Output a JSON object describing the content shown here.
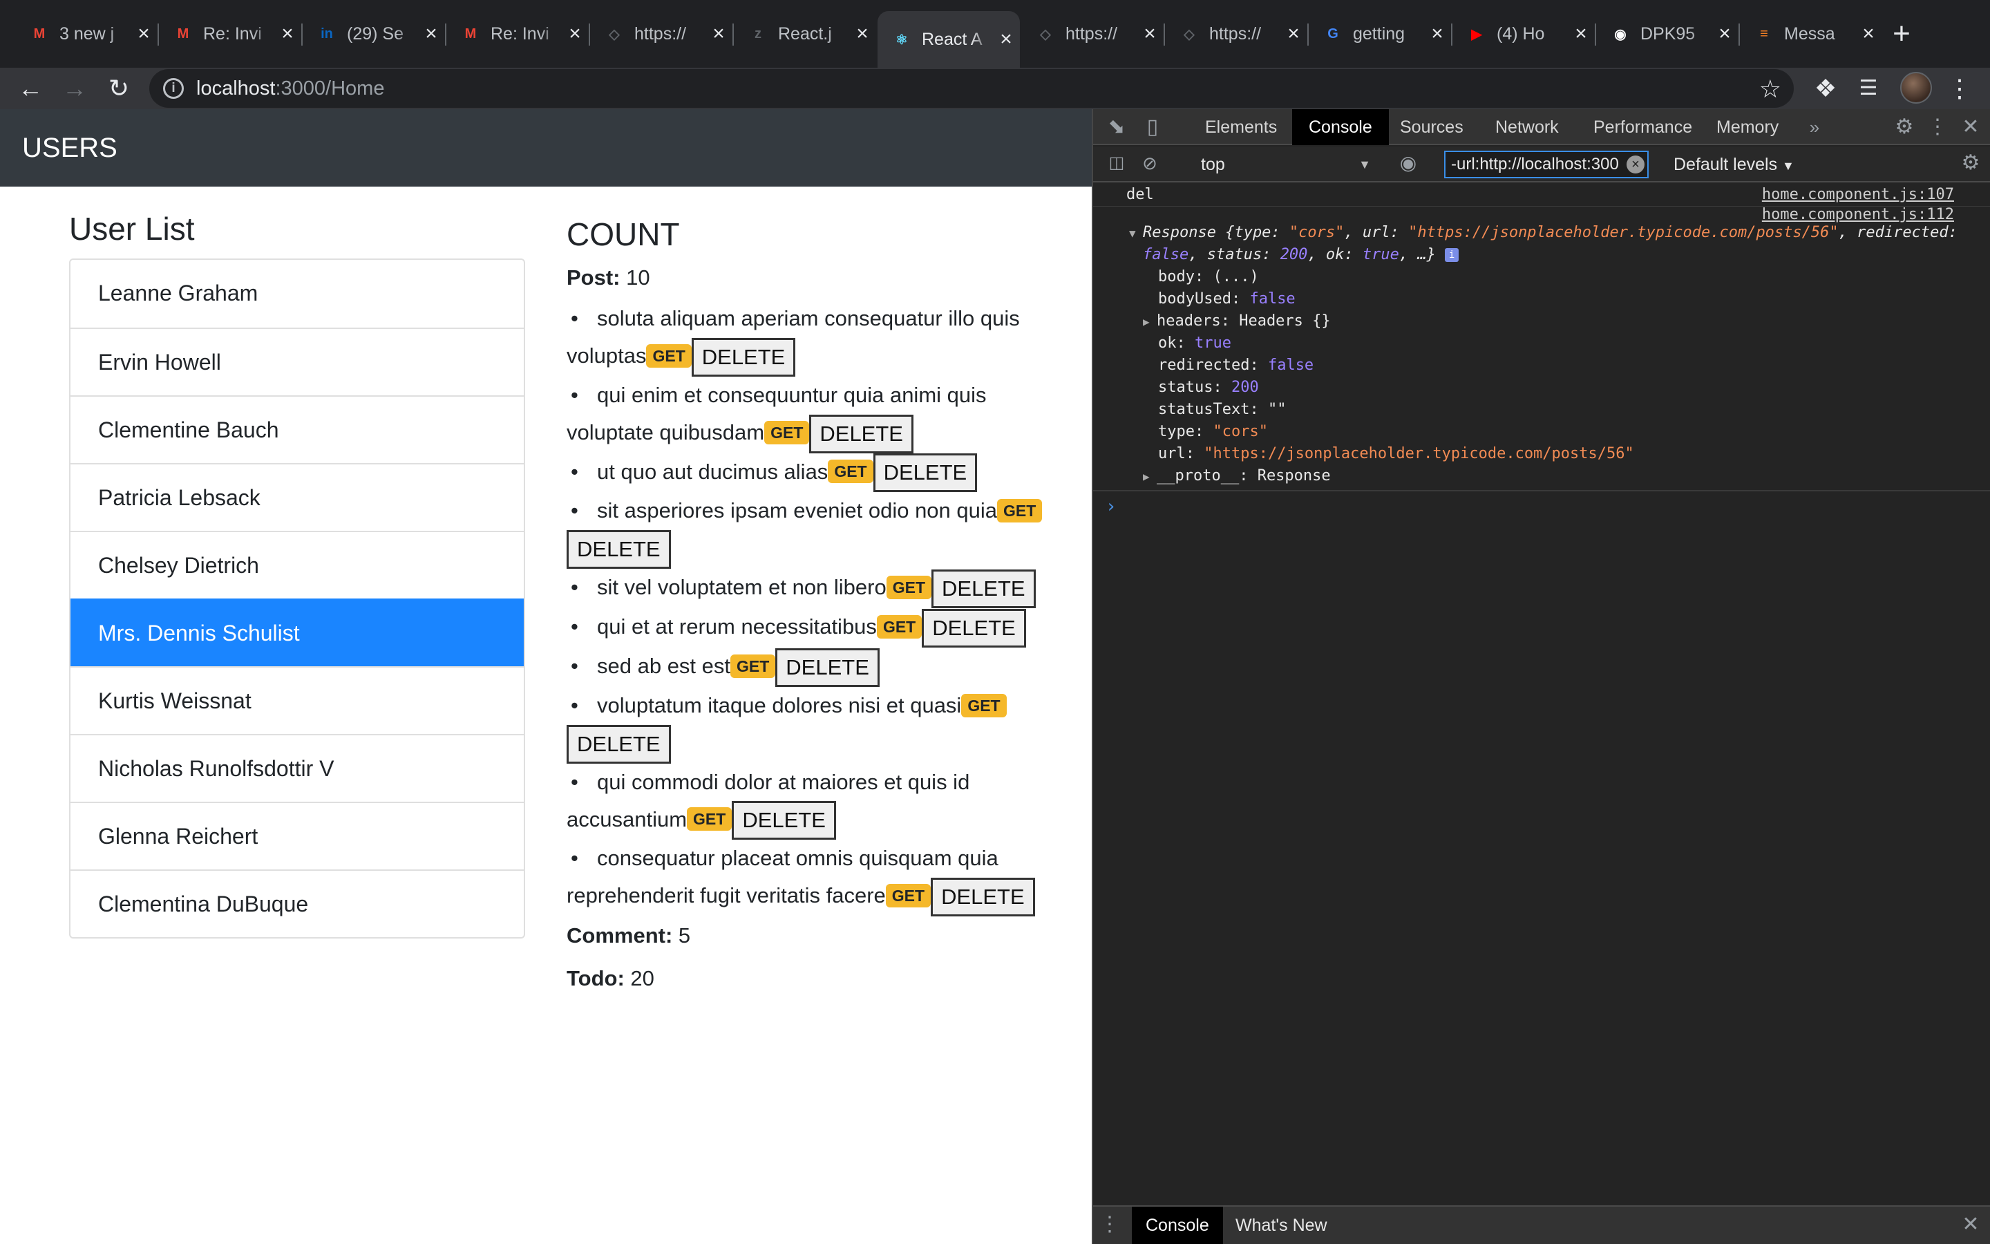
{
  "browser": {
    "tabs": [
      {
        "title": "3 new j",
        "icon": "gmail-icon",
        "color": "#ea4335"
      },
      {
        "title": "Re: Invi",
        "icon": "gmail-icon",
        "color": "#ea4335"
      },
      {
        "title": "(29) Se",
        "icon": "linkedin-icon",
        "color": "#0a66c2"
      },
      {
        "title": "Re: Invi",
        "icon": "gmail-icon",
        "color": "#ea4335"
      },
      {
        "title": "https://",
        "icon": "page-icon",
        "color": "#5f6368"
      },
      {
        "title": "React.j",
        "icon": "zeal-icon",
        "color": "#5f6368"
      },
      {
        "title": "React A",
        "icon": "react-icon",
        "color": "#61dafb"
      },
      {
        "title": "https://",
        "icon": "page-icon",
        "color": "#5f6368"
      },
      {
        "title": "https://",
        "icon": "page-icon",
        "color": "#5f6368"
      },
      {
        "title": "getting",
        "icon": "google-icon",
        "color": "#4285f4"
      },
      {
        "title": "(4) Ho",
        "icon": "youtube-icon",
        "color": "#ff0000"
      },
      {
        "title": "DPK95",
        "icon": "github-icon",
        "color": "#ffffff"
      },
      {
        "title": "Messa",
        "icon": "stackoverflow-icon",
        "color": "#f48024"
      }
    ],
    "active_tab": 6,
    "url_host": "localhost",
    "url_rest": ":3000/Home"
  },
  "app": {
    "brand": "USERS",
    "userlist_title": "User List",
    "users": [
      "Leanne Graham",
      "Ervin Howell",
      "Clementine Bauch",
      "Patricia Lebsack",
      "Chelsey Dietrich",
      "Mrs. Dennis Schulist",
      "Kurtis Weissnat",
      "Nicholas Runolfsdottir V",
      "Glenna Reichert",
      "Clementina DuBuque"
    ],
    "selected_user": 5,
    "count_title": "COUNT",
    "post_label": "Post:",
    "post_count": "10",
    "get_label": "GET",
    "delete_label": "DELETE",
    "posts": [
      "soluta aliquam aperiam consequatur illo quis voluptas",
      "qui enim et consequuntur quia animi quis voluptate quibusdam",
      "ut quo aut ducimus alias",
      "sit asperiores ipsam eveniet odio non quia",
      "sit vel voluptatem et non libero",
      "qui et at rerum necessitatibus",
      "sed ab est est",
      "voluptatum itaque dolores nisi et quasi",
      "qui commodi dolor at maiores et quis id accusantium",
      "consequatur placeat omnis quisquam quia reprehenderit fugit veritatis facere"
    ],
    "comment_label": "Comment:",
    "comment_count": "5",
    "todo_label": "Todo:",
    "todo_count": "20"
  },
  "devtools": {
    "tabs": [
      "Elements",
      "Console",
      "Sources",
      "Network",
      "Performance",
      "Memory"
    ],
    "active_tab": "Console",
    "context": "top",
    "filter": "-url:http://localhost:300",
    "levels": "Default levels",
    "log1": {
      "text": "del",
      "source": "home.component.js:107"
    },
    "log2": {
      "source": "home.component.js:112",
      "summary_prefix": "Response {type: ",
      "type_val": "\"cors\"",
      "url_key": ", url: ",
      "url_val": "\"https://jsonplaceholder.typicode.com/posts/56\"",
      "redirected_key": ", redirected:",
      "redirected_val": "false",
      "status_key": ", status: ",
      "status_val": "200",
      "ok_key": ", ok: ",
      "ok_val": "true",
      "tail": ", …}",
      "props": {
        "body": "body: (...)",
        "bodyUsed_k": "bodyUsed: ",
        "bodyUsed_v": "false",
        "headers": "headers: Headers {}",
        "ok_k": "ok: ",
        "ok_v": "true",
        "redirected_k": "redirected: ",
        "redirected_v": "false",
        "status_k": "status: ",
        "status_v": "200",
        "statusText_k": "statusText: ",
        "statusText_v": "\"\"",
        "type_k": "type: ",
        "type_v": "\"cors\"",
        "url_k": "url: ",
        "url_v": "\"https://jsonplaceholder.typicode.com/posts/56\"",
        "proto": "__proto__: Response"
      }
    },
    "drawer_tabs": [
      "Console",
      "What's New"
    ]
  }
}
